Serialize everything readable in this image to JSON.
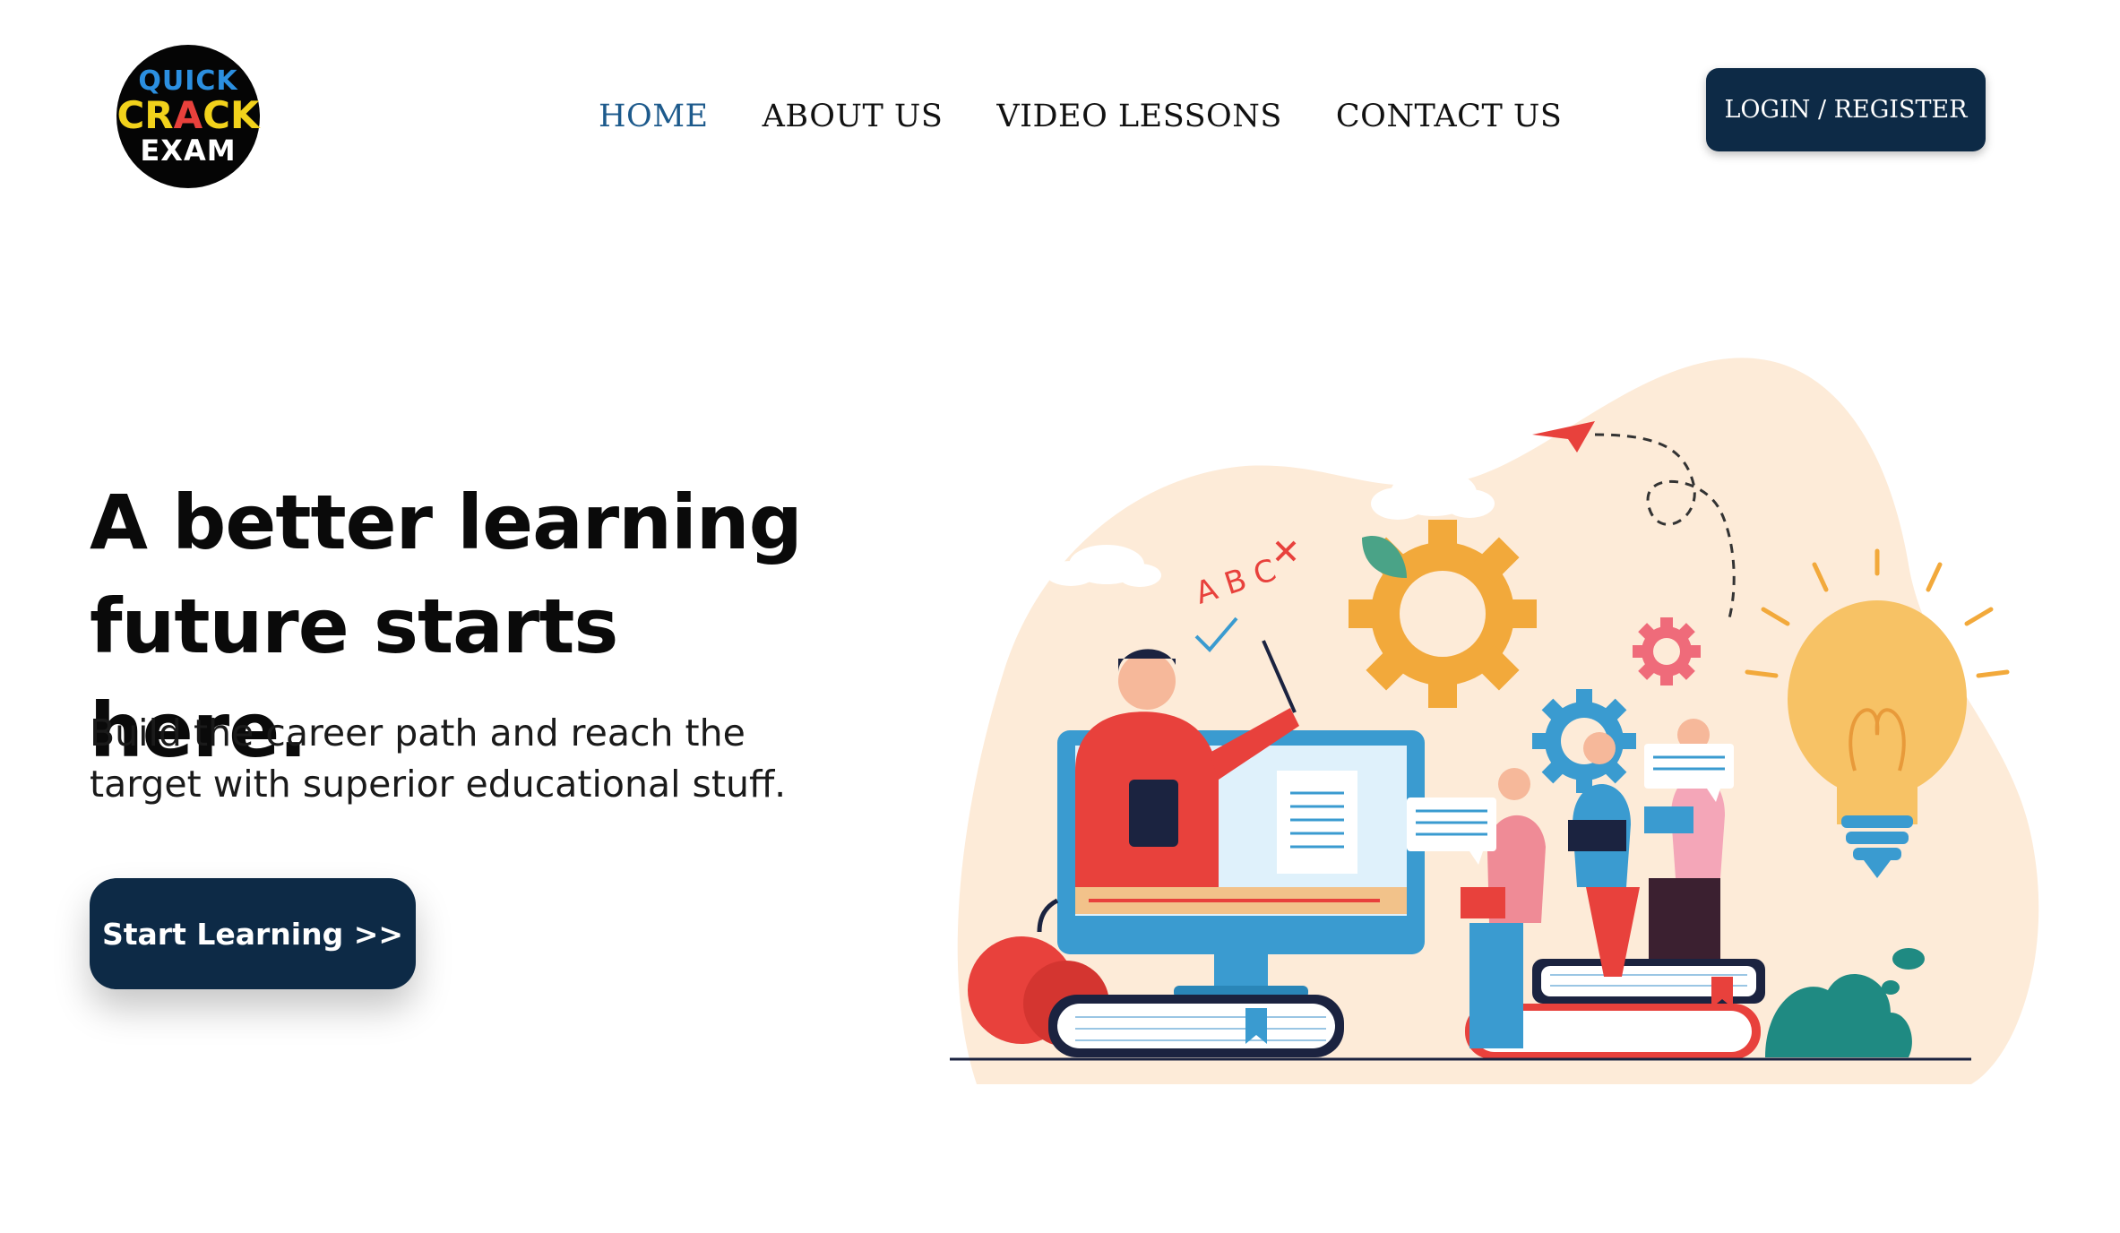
{
  "header": {
    "logo": {
      "line1": "QUICK",
      "line2": "CRACK",
      "line3": "EXAM"
    },
    "nav": [
      {
        "label": "HOME",
        "active": true
      },
      {
        "label": "ABOUT US",
        "active": false
      },
      {
        "label": "VIDEO LESSONS",
        "active": false
      },
      {
        "label": "CONTACT US",
        "active": false
      }
    ],
    "login_label": "LOGIN / REGISTER"
  },
  "hero": {
    "title_line1": "A better learning",
    "title_line2": "future starts here.",
    "subtitle_line1": "Build the career path and reach the",
    "subtitle_line2": "target with superior educational stuff.",
    "cta_label": "Start Learning >>"
  },
  "illustration": {
    "board_letters": "A B C"
  },
  "colors": {
    "primary_dark": "#0d2a46",
    "nav_active": "#1d5a8c",
    "blob": "#fdebd8",
    "gear_orange": "#f2a93b",
    "gear_blue": "#3a9bd0",
    "gear_pink": "#ef6b7a",
    "red": "#e8413c",
    "bulb": "#f7c265",
    "teal": "#1f8a82"
  }
}
